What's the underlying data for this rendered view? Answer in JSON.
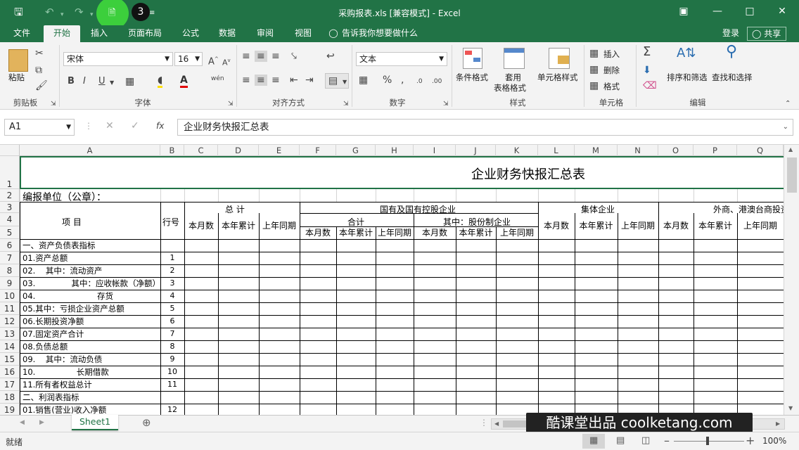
{
  "window": {
    "title": "采购报表.xls  [兼容模式] - Excel",
    "qat_badge": "3"
  },
  "tabs": [
    "文件",
    "开始",
    "插入",
    "页面布局",
    "公式",
    "数据",
    "审阅",
    "视图"
  ],
  "active_tab": "开始",
  "tell_me": "告诉我你想要做什么",
  "signin": "登录",
  "share": "共享",
  "ribbon": {
    "paste": "粘贴",
    "clipboard": "剪贴板",
    "font_name": "宋体",
    "font_size": "16",
    "font_group": "字体",
    "align_group": "对齐方式",
    "number_format": "文本",
    "number_group": "数字",
    "percent": "%",
    "comma": ",",
    "cond_format": "条件格式",
    "table_format_1": "套用",
    "table_format_2": "表格格式",
    "cell_style": "单元格样式",
    "style_group": "样式",
    "insert": "插入",
    "delete": "删除",
    "format": "格式",
    "cells_group": "单元格",
    "sort_filter": "排序和筛选",
    "find_select": "查找和选择",
    "edit_group": "编辑",
    "bold": "B",
    "italic": "I",
    "underline": "U",
    "phonetic": "wén"
  },
  "formula_bar": {
    "name_box": "A1",
    "formula": "企业财务快报汇总表",
    "fx": "fx"
  },
  "columns": [
    "A",
    "B",
    "C",
    "D",
    "E",
    "F",
    "G",
    "H",
    "I",
    "J",
    "K",
    "L",
    "M",
    "N",
    "O",
    "P",
    "Q"
  ],
  "rows": [
    "1",
    "2",
    "3",
    "4",
    "5",
    "6",
    "7",
    "8",
    "9",
    "10",
    "11",
    "12",
    "13",
    "14",
    "15",
    "16",
    "17",
    "18",
    "19"
  ],
  "cells": {
    "title": "企业财务快报汇总表",
    "unit": "编报单位（公章）：",
    "item": "项          目",
    "row_no": "行号",
    "total": "总      计",
    "state_owned": "国有及国有控股企业",
    "subtotal": "合计",
    "shareholding": "其中：股份制企业",
    "collective": "集体企业",
    "foreign": "外商、港澳台商投资",
    "this_month": "本月数",
    "ytd": "本年累计",
    "last_year": "上年同期",
    "items": [
      {
        "label": "一、资产负债表指标",
        "no": ""
      },
      {
        "label": "01.资产总额",
        "no": "1"
      },
      {
        "label": "02.    其中：流动资产",
        "no": "2"
      },
      {
        "label": "03.              其中：应收帐款（净额）",
        "no": "3"
      },
      {
        "label": "04.                        存货",
        "no": "4"
      },
      {
        "label": "05.其中：亏损企业资产总额",
        "no": "5"
      },
      {
        "label": "06.长期投资净额",
        "no": "6"
      },
      {
        "label": "07.固定资产合计",
        "no": "7"
      },
      {
        "label": "08.负债总额",
        "no": "8"
      },
      {
        "label": "09.    其中：流动负债",
        "no": "9"
      },
      {
        "label": "10.                长期借款",
        "no": "10"
      },
      {
        "label": "11.所有者权益总计",
        "no": "11"
      },
      {
        "label": "二、利润表指标",
        "no": ""
      },
      {
        "label": "01.销售(营业)收入净额",
        "no": "12"
      }
    ]
  },
  "sheet_tab": "Sheet1",
  "status": "就绪",
  "zoom": "100%",
  "watermark": "酷课堂出品 coolketang.com"
}
